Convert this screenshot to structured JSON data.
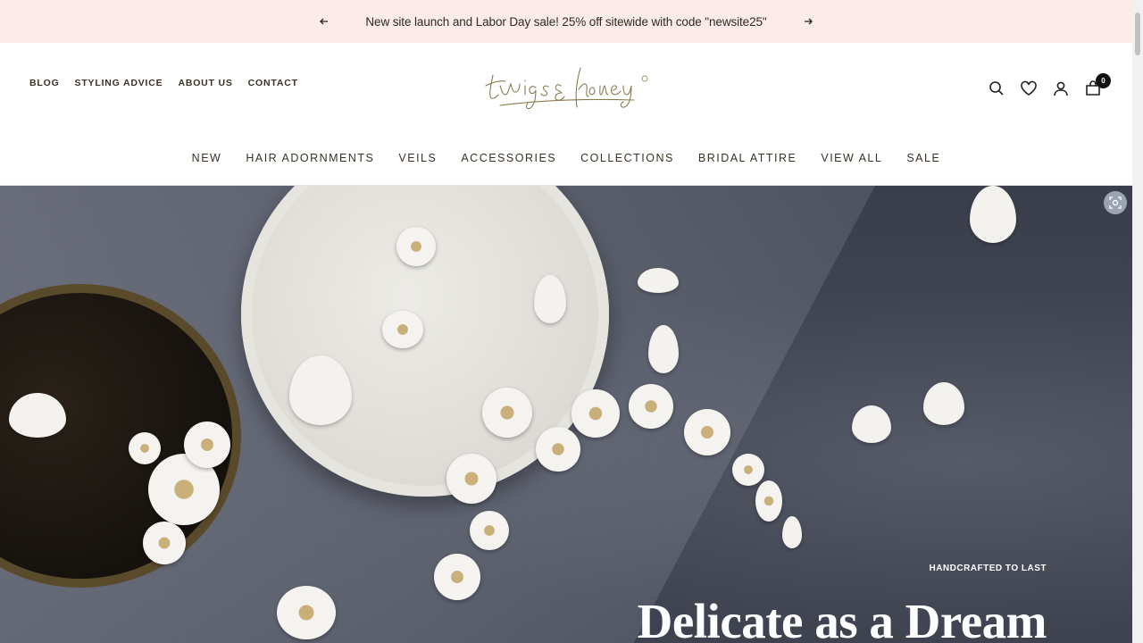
{
  "announcement": {
    "text": "New site launch and Labor Day sale! 25% off sitewide with code \"newsite25\"",
    "prev_icon": "arrow-left-icon",
    "next_icon": "arrow-right-icon"
  },
  "secondary_nav": [
    "BLOG",
    "STYLING ADVICE",
    "ABOUT US",
    "CONTACT"
  ],
  "logo": {
    "text": "twigs & honey"
  },
  "header_icons": {
    "search": "search-icon",
    "wishlist": "heart-icon",
    "account": "user-icon",
    "cart": "bag-icon",
    "cart_count": "0"
  },
  "main_nav": [
    "NEW",
    "HAIR ADORNMENTS",
    "VEILS",
    "ACCESSORIES",
    "COLLECTIONS",
    "BRIDAL ATTIRE",
    "VIEW ALL",
    "SALE"
  ],
  "hero": {
    "eyebrow": "HANDCRAFTED TO LAST",
    "headline": "Delicate as a Dream",
    "lens_icon": "lens-scan-icon"
  },
  "colors": {
    "announcement_bg": "#fcebe9",
    "nav_text": "#3a3226",
    "logo_gold": "#8a7a52",
    "hero_bg": "#3f4350"
  }
}
